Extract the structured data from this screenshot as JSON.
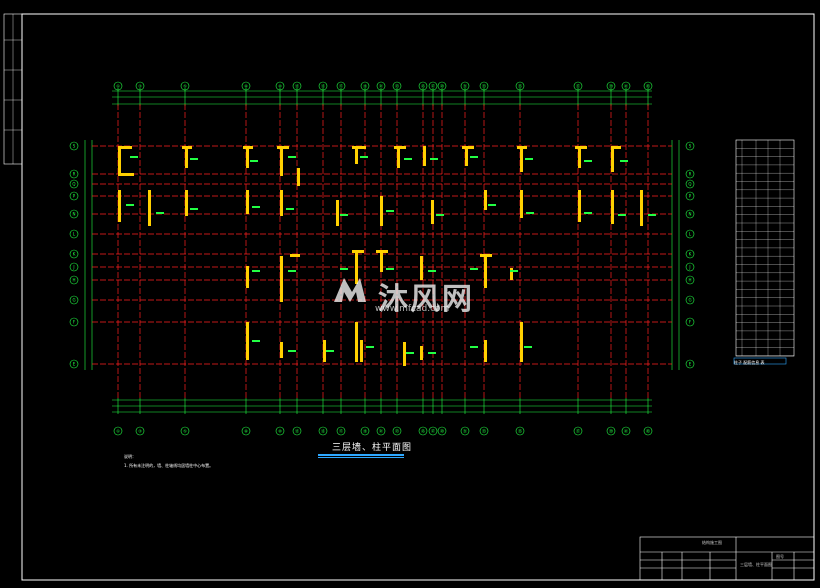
{
  "drawing": {
    "title": "三层墙、柱平面图",
    "notes": [
      "说明：",
      "1. 所有未注明的，墙、柱轴线均居墙柱中心布置。"
    ],
    "watermark_text": "沐风网",
    "watermark_url": "www.mfcad.com",
    "legend_title": "柱子 配筋信息 表"
  },
  "colors": {
    "background": "#000000",
    "grid_line": "#ff2020",
    "wall": "#ffd000",
    "annotation": "#22ff44",
    "border": "#ffffff",
    "title_underline": "#2ea8ff"
  },
  "axes_top": [
    "①",
    "③",
    "⑤",
    "⑧",
    "⑩",
    "⑬",
    "⑮",
    "⑰",
    "⑲",
    "㉑",
    "㉓",
    "㉕",
    "㉗",
    "㉙",
    "㉛",
    "㉝",
    "㉟",
    "㊲",
    "㊴",
    "㊶",
    "㊸"
  ],
  "axes_left": [
    "S",
    "R",
    "Q",
    "P",
    "N",
    "L",
    "K",
    "J",
    "H",
    "G",
    "F",
    "E",
    "D",
    "C",
    "B",
    "A"
  ],
  "title_block": {
    "cell_1": "结构施工图",
    "cell_2": "三层墙、柱平面图",
    "cell_3": "图号"
  }
}
